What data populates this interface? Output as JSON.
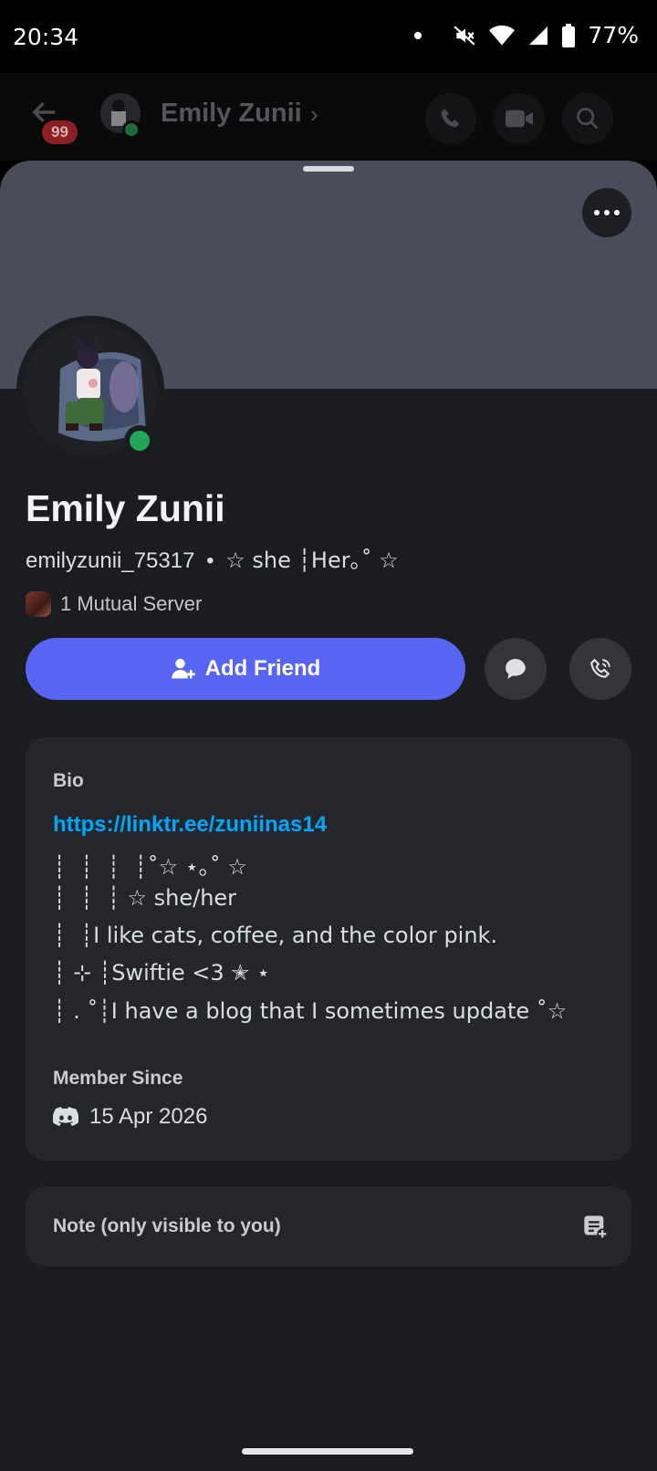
{
  "status_bar": {
    "time": "20:34",
    "battery": "77%"
  },
  "chat_header": {
    "unread_badge": "99",
    "name": "Emily Zunii"
  },
  "profile": {
    "display_name": "Emily Zunii",
    "username": "emilyzunii_75317",
    "separator": "•",
    "pronouns": "☆ she ┆Her｡˚ ☆",
    "mutual_servers": "1 Mutual Server",
    "status_color": "#23a55a"
  },
  "actions": {
    "add_friend_label": "Add Friend"
  },
  "bio": {
    "title": "Bio",
    "link": "https://linktr.ee/zuniinas14",
    "lines": [
      "┊  ┊  ┊  ┊˚☆ ⋆｡˚ ☆",
      "┊  ┊  ┊ ☆ she/her",
      "┊  ┊I like cats, coffee, and the color pink.",
      "┊ ⊹ ┊Swiftie <3 ✭ ⋆",
      "┊ . ˚┊I have a blog that I sometimes update ˚☆"
    ]
  },
  "member_since": {
    "title": "Member Since",
    "date": "15 Apr 2026"
  },
  "note": {
    "label": "Note (only visible to you)"
  },
  "colors": {
    "accent": "#5865f2",
    "link": "#00a8fc",
    "banner": "#4b4c5a",
    "background": "#1b1c20"
  }
}
